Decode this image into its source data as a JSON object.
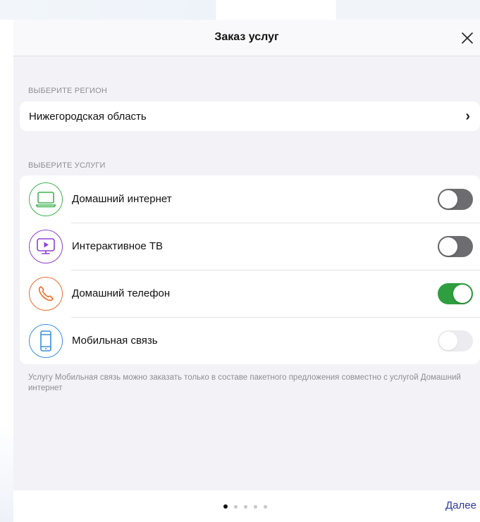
{
  "modal": {
    "title": "Заказ услуг",
    "close_icon": "close-icon"
  },
  "region": {
    "section_label": "ВЫБЕРИТЕ РЕГИОН",
    "value": "Нижегородская область",
    "chevron": "›"
  },
  "services": {
    "section_label": "ВЫБЕРИТЕ УСЛУГИ",
    "items": [
      {
        "label": "Домашний интернет",
        "icon": "laptop-icon",
        "color": "#3fb34f",
        "enabled": false,
        "disabled": false
      },
      {
        "label": "Интерактивное ТВ",
        "icon": "tv-play-icon",
        "color": "#8e3fd6",
        "enabled": false,
        "disabled": false
      },
      {
        "label": "Домашний телефон",
        "icon": "phone-icon",
        "color": "#f26b2a",
        "enabled": true,
        "disabled": false
      },
      {
        "label": "Мобильная связь",
        "icon": "mobile-icon",
        "color": "#3a8fd9",
        "enabled": false,
        "disabled": true
      }
    ],
    "note": "Услугу Мобильная связь можно заказать только в составе пакетного предложения совместно с услугой Домашний интернет"
  },
  "pager": {
    "pages": 5,
    "current": 1,
    "next_label": "Далее"
  },
  "colors": {
    "toggle_on": "#2e9e3e",
    "toggle_off": "#6d6d70",
    "link": "#2a3a9c"
  }
}
